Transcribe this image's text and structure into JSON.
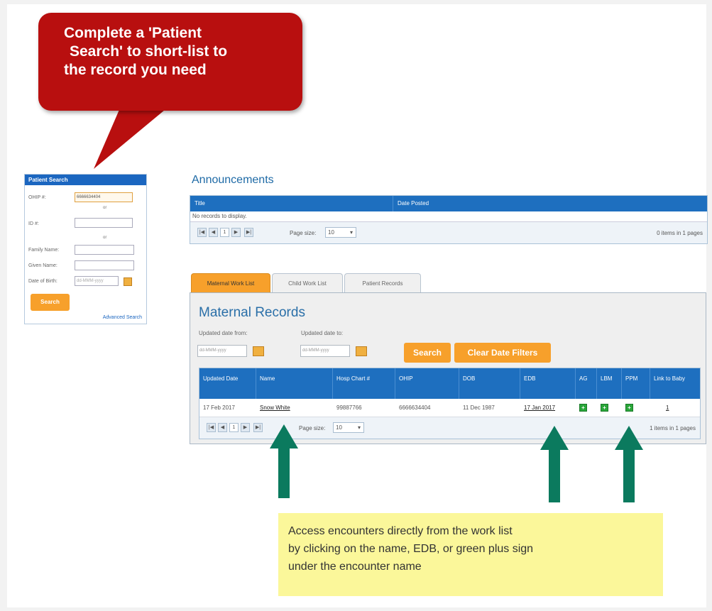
{
  "callout": {
    "lines": [
      "Complete a 'Patient",
      "Search' to short-list to",
      "the record you need"
    ],
    "color": "#b80f0f"
  },
  "patient_search": {
    "title": "Patient Search",
    "ohip_label": "OHIP #:",
    "ohip_value": "6666634404",
    "or1": "or",
    "id_label": "ID #:",
    "or2": "or",
    "family_name_label": "Family Name:",
    "given_name_label": "Given Name:",
    "dob_label": "Date of Birth:",
    "dob_placeholder": "dd-MMM-yyyy",
    "search_button": "Search",
    "advanced_search": "Advanced Search"
  },
  "announcements": {
    "title": "Announcements",
    "columns": [
      "Title",
      "Date Posted"
    ],
    "empty_text": "No records to display.",
    "pager": {
      "first": "|◀",
      "prev": "◀",
      "page": "1",
      "next": "▶",
      "last": "▶|",
      "page_size_label": "Page size:",
      "page_size": "10",
      "items_text": "0 items in 1 pages"
    }
  },
  "tabs": [
    "Maternal Work List",
    "Child Work List",
    "Patient Records"
  ],
  "maternal": {
    "title": "Maternal Records",
    "date_from_label": "Updated date from:",
    "date_to_label": "Updated date to:",
    "date_placeholder": "dd-MMM-yyyy",
    "search_button": "Search",
    "clear_button": "Clear Date Filters",
    "columns": [
      "Updated Date",
      "Name",
      "Hosp Chart #",
      "OHIP",
      "DOB",
      "EDB",
      "AG",
      "LBM",
      "PPM",
      "Link to Baby"
    ],
    "rows": [
      {
        "updated": "17 Feb 2017",
        "name": "Snow White",
        "chart": "99887766",
        "ohip": "6666634404",
        "dob": "11 Dec 1987",
        "edb": "17 Jan 2017",
        "ag": "+",
        "lbm": "+",
        "ppm": "+",
        "link": "1"
      }
    ],
    "pager": {
      "first": "|◀",
      "prev": "◀",
      "page": "1",
      "next": "▶",
      "last": "▶|",
      "page_size_label": "Page size:",
      "page_size": "10",
      "items_text": "1 items in 1 pages"
    }
  },
  "note": {
    "lines": [
      "Access encounters directly from the work list",
      "by clicking on the name, EDB, or green plus sign",
      "under the encounter name"
    ]
  },
  "colors": {
    "header_blue": "#1e6fbf",
    "orange": "#f7a02b",
    "arrow_green": "#0b7a5e",
    "note_yellow": "#fbf79a"
  }
}
